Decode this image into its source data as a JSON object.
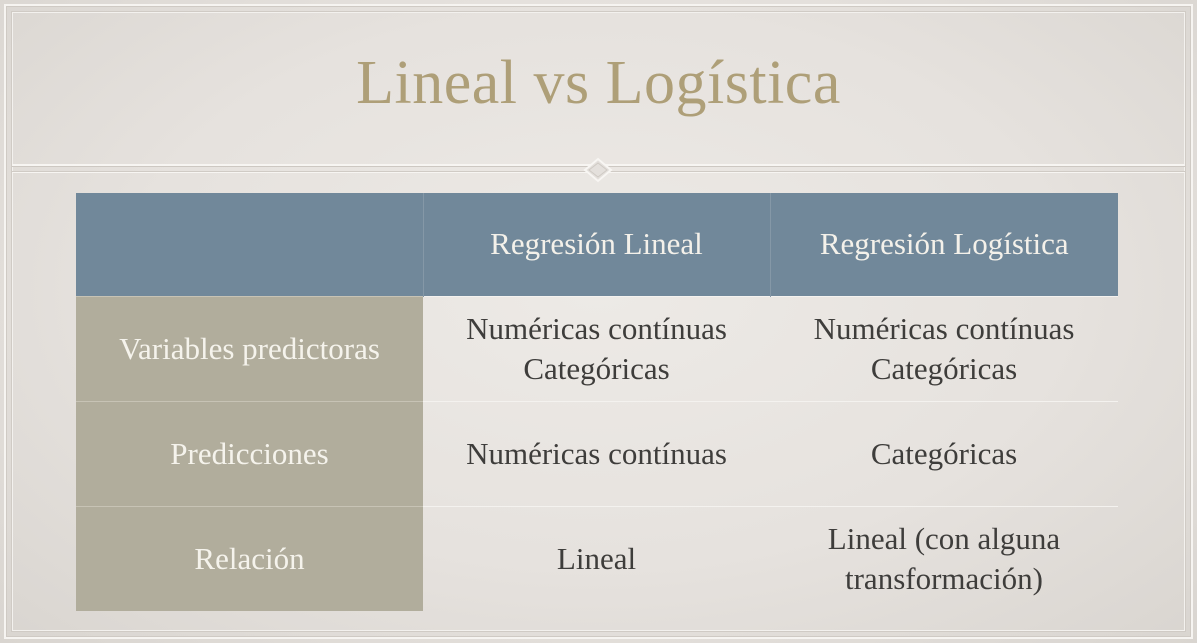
{
  "slide": {
    "title": "Lineal vs Logística"
  },
  "table": {
    "header": [
      "",
      "Regresión Lineal",
      "Regresión Logística"
    ],
    "rows": [
      {
        "label": "Variables predictoras",
        "linear": [
          "Numéricas contínuas",
          "Categóricas"
        ],
        "logistic": [
          "Numéricas contínuas",
          "Categóricas"
        ]
      },
      {
        "label": "Predicciones",
        "linear": [
          "Numéricas contínuas"
        ],
        "logistic": [
          "Categóricas"
        ]
      },
      {
        "label": "Relación",
        "linear": [
          "Lineal"
        ],
        "logistic": [
          "Lineal (con alguna",
          "transformación)"
        ]
      }
    ]
  },
  "colors": {
    "title": "#ae9f78",
    "header_bg": "#71889a",
    "row_header_bg": "#b1ad9c",
    "background": "#e6e2de"
  }
}
